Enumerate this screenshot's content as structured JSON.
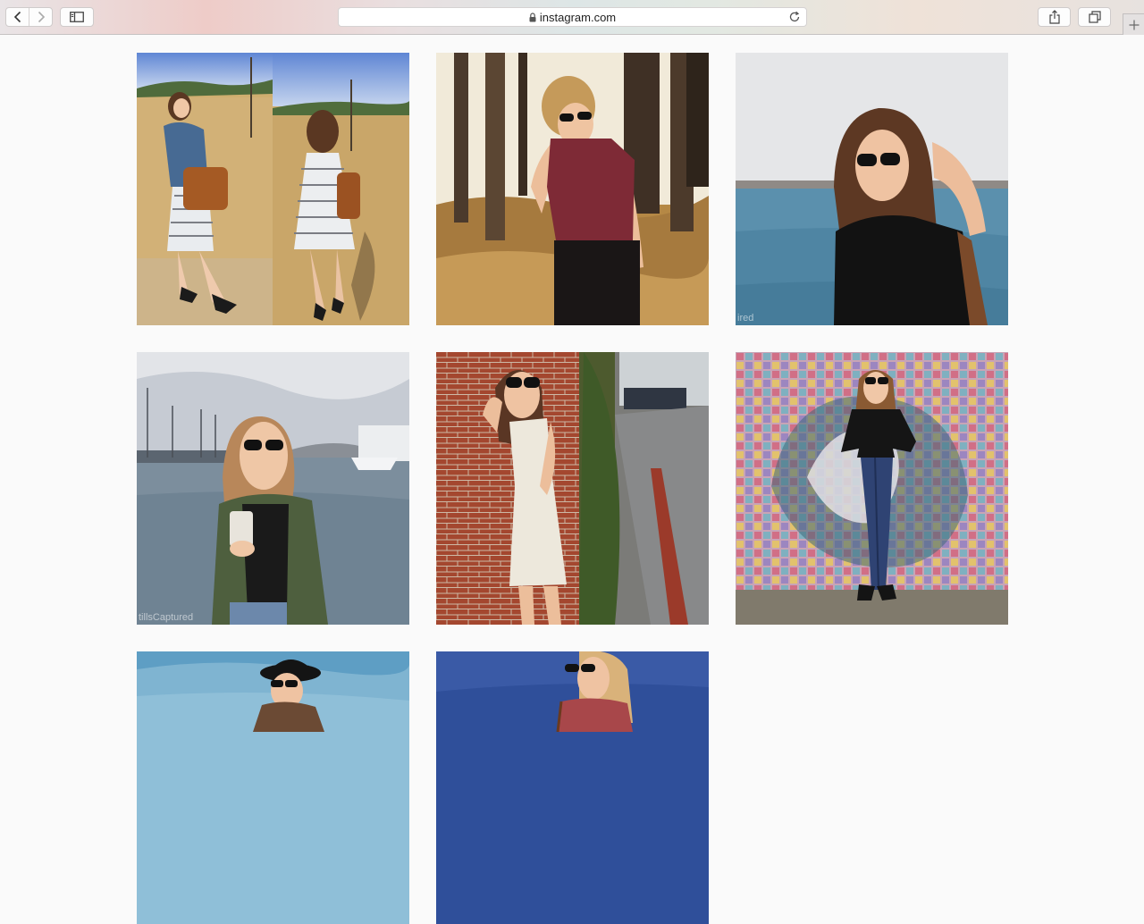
{
  "browser": {
    "url": "instagram.com",
    "icons": {
      "back": "chevron-left-icon",
      "forward": "chevron-right-icon",
      "sidebar": "sidebar-icon",
      "lock": "lock-icon",
      "reload": "reload-icon",
      "share": "share-icon",
      "tabs": "tabs-overview-icon",
      "new_tab": "plus-icon"
    }
  },
  "feed": {
    "posts": [
      {
        "watermark": ""
      },
      {
        "watermark": ""
      },
      {
        "watermark": "ired"
      },
      {
        "watermark": "tillsCaptured"
      },
      {
        "watermark": ""
      },
      {
        "watermark": ""
      },
      {
        "watermark": ""
      },
      {
        "watermark": ""
      }
    ]
  }
}
